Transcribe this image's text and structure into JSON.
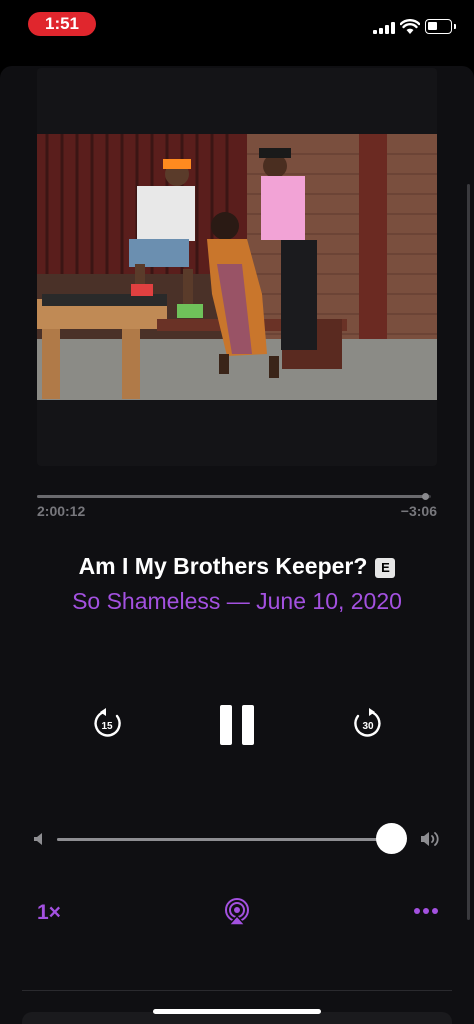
{
  "status_bar": {
    "time": "1:51",
    "icons": [
      "cellular-signal-icon",
      "wifi-icon",
      "battery-icon"
    ]
  },
  "player": {
    "artwork": "podcast-episode-artwork",
    "progress": {
      "elapsed": "2:00:12",
      "remaining": "−3:06",
      "fraction": 0.985
    },
    "episode_title": "Am I My Brothers Keeper?",
    "explicit_badge": "E",
    "subtitle": "So Shameless — June 10, 2020",
    "controls": {
      "skip_back_seconds": "15",
      "skip_forward_seconds": "30",
      "state": "playing"
    },
    "volume": {
      "level": 1.0
    },
    "playback_speed": "1×",
    "icons": [
      "volume-low-icon",
      "volume-high-icon",
      "airplay-icon",
      "more-icon"
    ]
  },
  "colors": {
    "accent": "#a351e0",
    "time_pill": "#e0262d",
    "background": "#0f0f12"
  }
}
